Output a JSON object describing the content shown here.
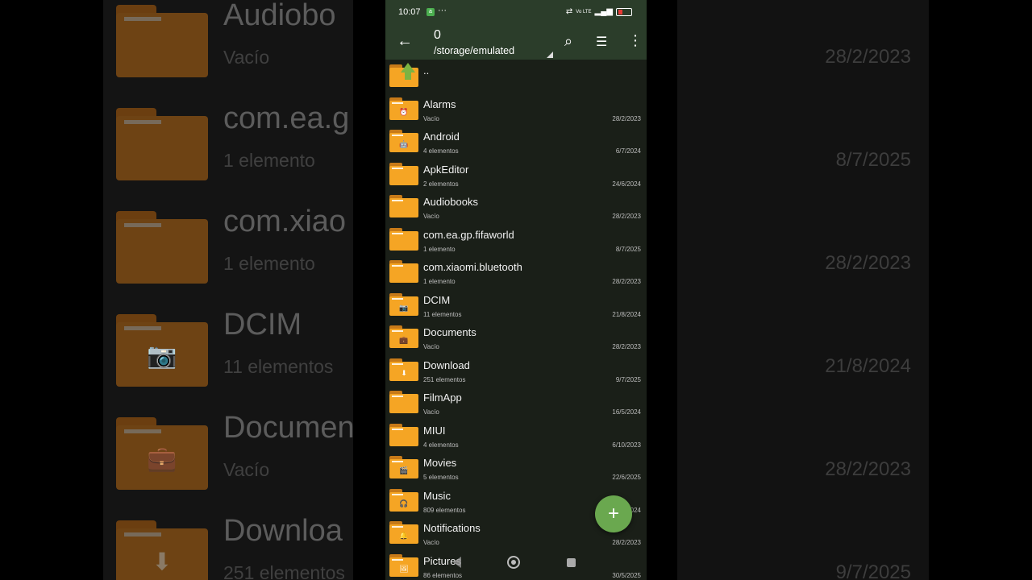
{
  "status": {
    "time": "10:07",
    "dots": "···",
    "signal_text": "Vo LTE"
  },
  "toolbar": {
    "count": "0",
    "path": "/storage/emulated"
  },
  "parent": {
    "label": ".."
  },
  "items": [
    {
      "name": "Alarms",
      "count": "Vacío",
      "date": "28/2/2023",
      "glyph": "⏰",
      "icon": "alarm-icon"
    },
    {
      "name": "Android",
      "count": "4 elementos",
      "date": "6/7/2024",
      "glyph": "🤖",
      "icon": "android-icon"
    },
    {
      "name": "ApkEditor",
      "count": "2 elementos",
      "date": "24/6/2024",
      "glyph": "",
      "icon": "folder-icon"
    },
    {
      "name": "Audiobooks",
      "count": "Vacío",
      "date": "28/2/2023",
      "glyph": "",
      "icon": "folder-icon"
    },
    {
      "name": "com.ea.gp.fifaworld",
      "count": "1 elemento",
      "date": "8/7/2025",
      "glyph": "",
      "icon": "folder-icon"
    },
    {
      "name": "com.xiaomi.bluetooth",
      "count": "1 elemento",
      "date": "28/2/2023",
      "glyph": "",
      "icon": "folder-icon"
    },
    {
      "name": "DCIM",
      "count": "11 elementos",
      "date": "21/8/2024",
      "glyph": "📷",
      "icon": "camera-icon"
    },
    {
      "name": "Documents",
      "count": "Vacío",
      "date": "28/2/2023",
      "glyph": "💼",
      "icon": "briefcase-icon"
    },
    {
      "name": "Download",
      "count": "251 elementos",
      "date": "9/7/2025",
      "glyph": "⬇",
      "icon": "download-icon"
    },
    {
      "name": "FilmApp",
      "count": "Vacío",
      "date": "16/5/2024",
      "glyph": "",
      "icon": "folder-icon"
    },
    {
      "name": "MIUI",
      "count": "4 elementos",
      "date": "6/10/2023",
      "glyph": "",
      "icon": "folder-icon"
    },
    {
      "name": "Movies",
      "count": "5 elementos",
      "date": "22/6/2025",
      "glyph": "🎬",
      "icon": "clapperboard-icon"
    },
    {
      "name": "Music",
      "count": "809 elementos",
      "date": "…/2024",
      "glyph": "🎧",
      "icon": "headphones-icon"
    },
    {
      "name": "Notifications",
      "count": "Vacío",
      "date": "28/2/2023",
      "glyph": "🔔",
      "icon": "bell-icon"
    },
    {
      "name": "Pictures",
      "count": "86 elementos",
      "date": "30/5/2025",
      "glyph": "🖼",
      "icon": "image-icon"
    }
  ],
  "fab": {
    "label": "+"
  },
  "background": {
    "left": [
      {
        "name": "Audiobo",
        "sub": "Vacío",
        "glyph": ""
      },
      {
        "name": "com.ea.g",
        "sub": "1 elemento",
        "glyph": ""
      },
      {
        "name": "com.xiao",
        "sub": "1 elemento",
        "glyph": ""
      },
      {
        "name": "DCIM",
        "sub": "11 elementos",
        "glyph": "📷"
      },
      {
        "name": "Documen",
        "sub": "Vacío",
        "glyph": "💼"
      },
      {
        "name": "Downloa",
        "sub": "251 elementos",
        "glyph": "⬇"
      }
    ],
    "right": [
      "28/2/2023",
      "8/7/2025",
      "28/2/2023",
      "21/8/2024",
      "28/2/2023",
      "9/7/2025"
    ]
  },
  "colors": {
    "toolbar": "#2b3d2a",
    "folder": "#f5a524",
    "fab": "#6aa84f",
    "list_bg": "#1a1f18"
  }
}
